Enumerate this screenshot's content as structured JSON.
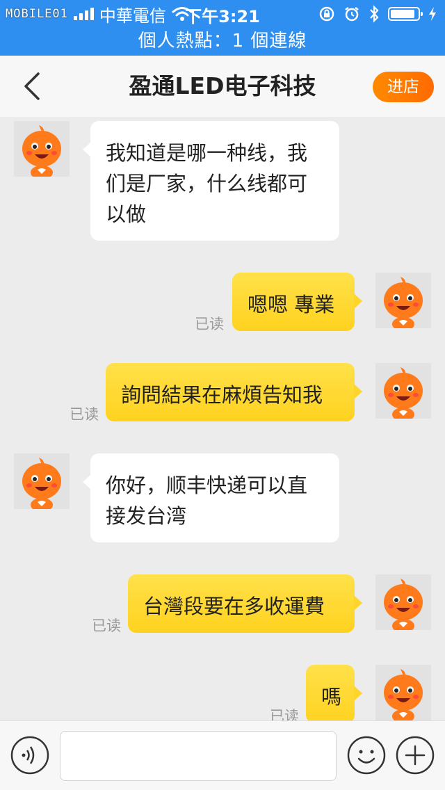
{
  "status_bar": {
    "watermark": "MOBILE01",
    "carrier": "中華電信",
    "time": "下午3:21",
    "signal_bars": 4,
    "battery_level": 0.9
  },
  "hotspot_banner": "個人熱點：1 個連線",
  "nav": {
    "back_icon": "chevron-left-icon",
    "title": "盈通LED电子科技",
    "shop_button": "进店",
    "accent_color": "#ff7a00"
  },
  "messages": [
    {
      "side": "in",
      "text": "我知道是哪一种线，我们是厂家，什么线都可以做",
      "read_label": ""
    },
    {
      "side": "out",
      "text": "嗯嗯 專業",
      "read_label": "已读"
    },
    {
      "side": "out",
      "text": "詢問結果在麻煩告知我",
      "read_label": "已读"
    },
    {
      "side": "in",
      "text": "你好，顺丰快递可以直接发台湾",
      "read_label": ""
    },
    {
      "side": "out",
      "text": "台灣段要在多收運費",
      "read_label": "已读"
    },
    {
      "side": "out",
      "text": "嗎",
      "read_label": "已读"
    }
  ],
  "input_bar": {
    "voice_icon": "voice-icon",
    "input_value": "",
    "emoji_icon": "emoji-icon",
    "plus_icon": "plus-icon"
  },
  "colors": {
    "status_bar_bg": "#2f8ff0",
    "outgoing_bubble": "#ffd52a",
    "incoming_bubble": "#ffffff",
    "chat_bg": "#ececec"
  }
}
